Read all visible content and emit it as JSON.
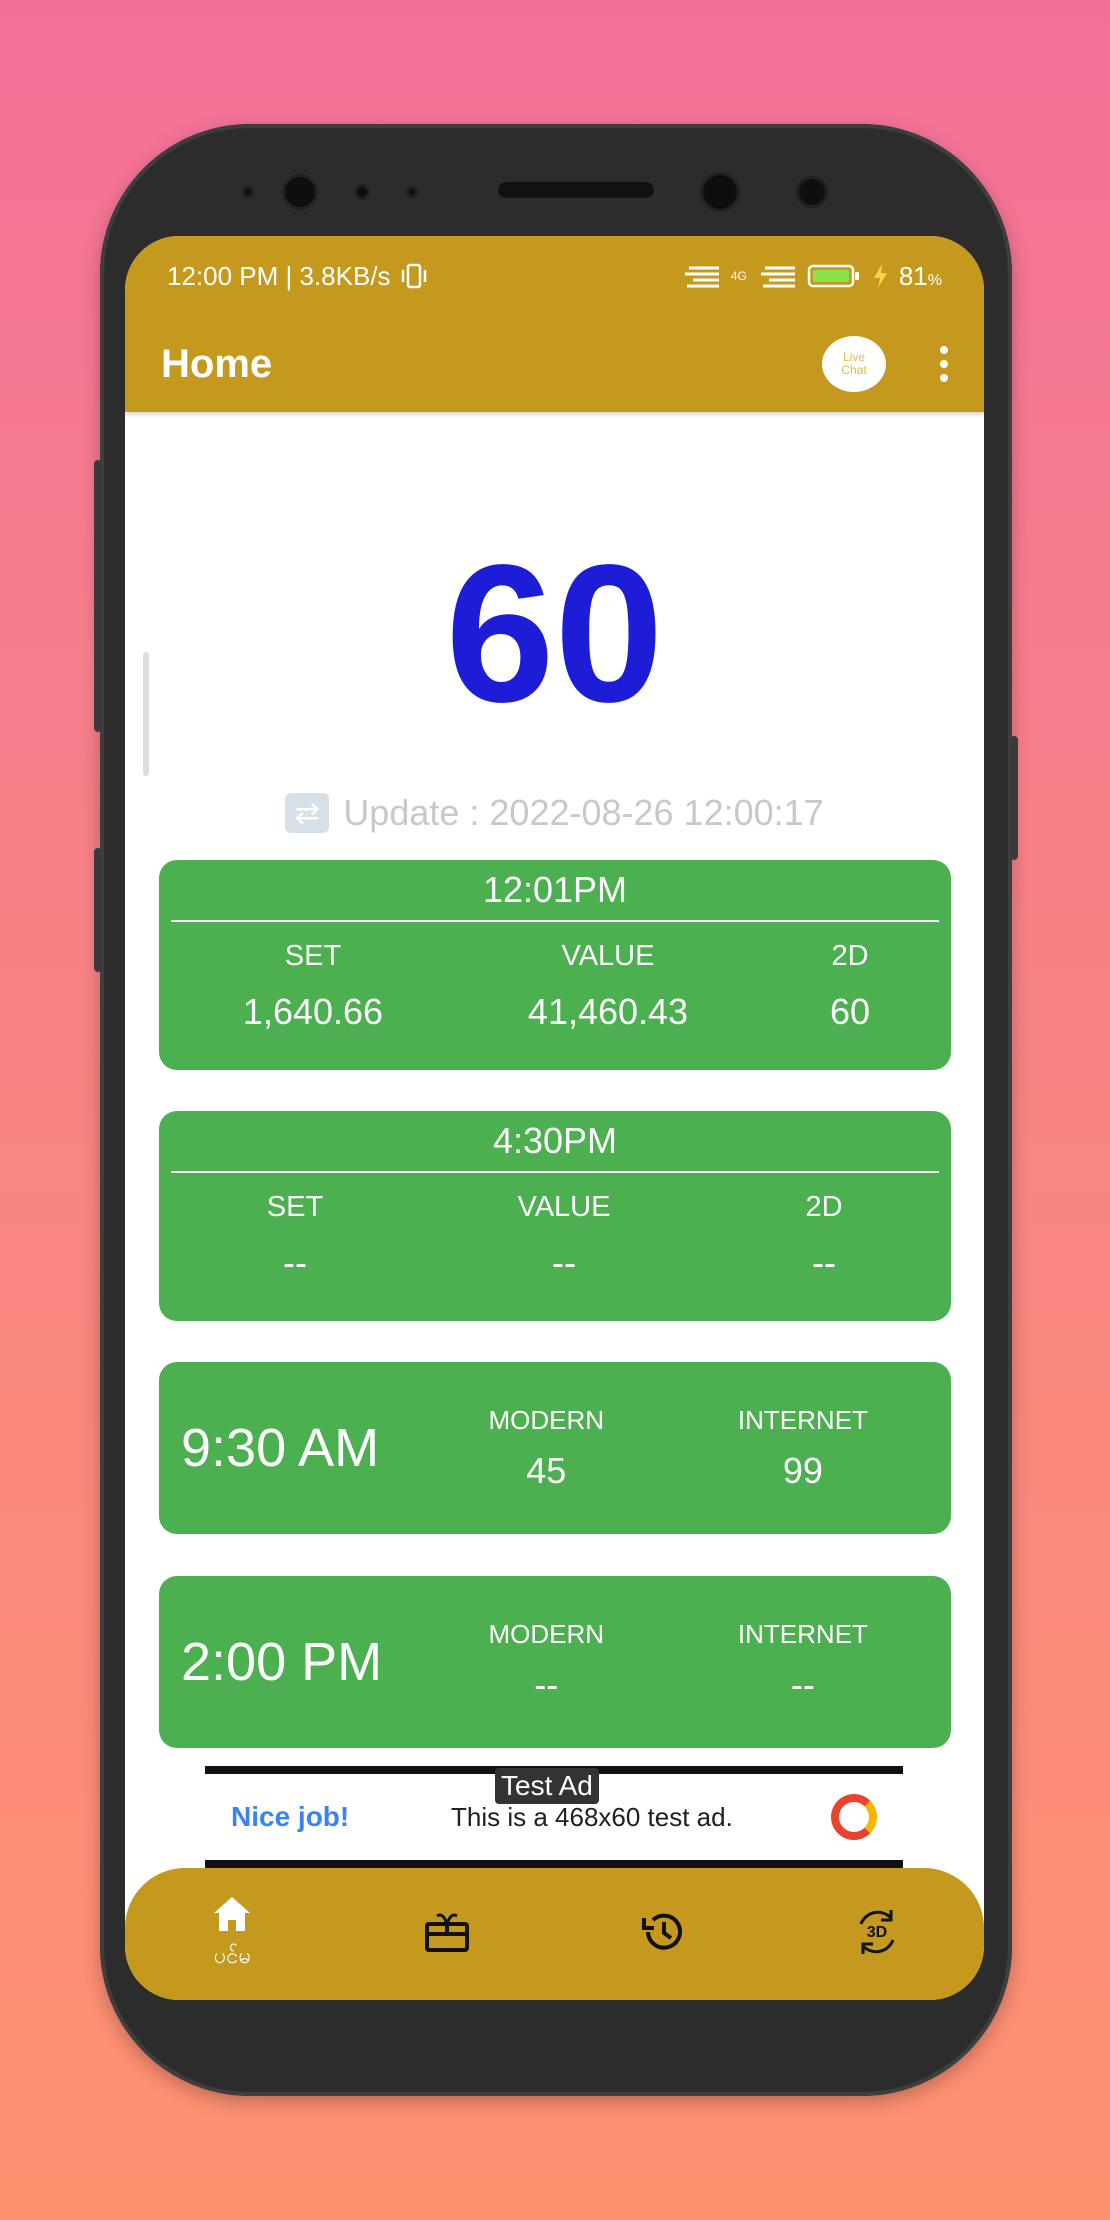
{
  "status_bar": {
    "time_speed": "12:00 PM | 3.8KB/s",
    "network": "4G",
    "battery": "81",
    "battery_unit": "%"
  },
  "app_bar": {
    "title": "Home",
    "live_chat_line1": "Live",
    "live_chat_line2": "Chat"
  },
  "main": {
    "number": "60",
    "update_text": "Update : 2022-08-26 12:00:17"
  },
  "results": [
    {
      "time": "12:01PM",
      "set_label": "SET",
      "set_value": "1,640.66",
      "value_label": "VALUE",
      "value_value": "41,460.43",
      "twod_label": "2D",
      "twod_value": "60"
    },
    {
      "time": "4:30PM",
      "set_label": "SET",
      "set_value": "--",
      "value_label": "VALUE",
      "value_value": "--",
      "twod_label": "2D",
      "twod_value": "--"
    }
  ],
  "modern_internet": [
    {
      "time": "9:30 AM",
      "modern_label": "MODERN",
      "modern_value": "45",
      "internet_label": "INTERNET",
      "internet_value": "99"
    },
    {
      "time": "2:00 PM",
      "modern_label": "MODERN",
      "modern_value": "--",
      "internet_label": "INTERNET",
      "internet_value": "--"
    }
  ],
  "ad": {
    "label": "Test Ad",
    "nice": "Nice job!",
    "text": "This is a 468x60 test ad."
  },
  "bottom_nav": {
    "home_label": "ပင်မ",
    "threed_text": "3D"
  },
  "colors": {
    "gold": "#C4991D",
    "green": "#4CAF50",
    "number_blue": "#1D1CD6"
  }
}
